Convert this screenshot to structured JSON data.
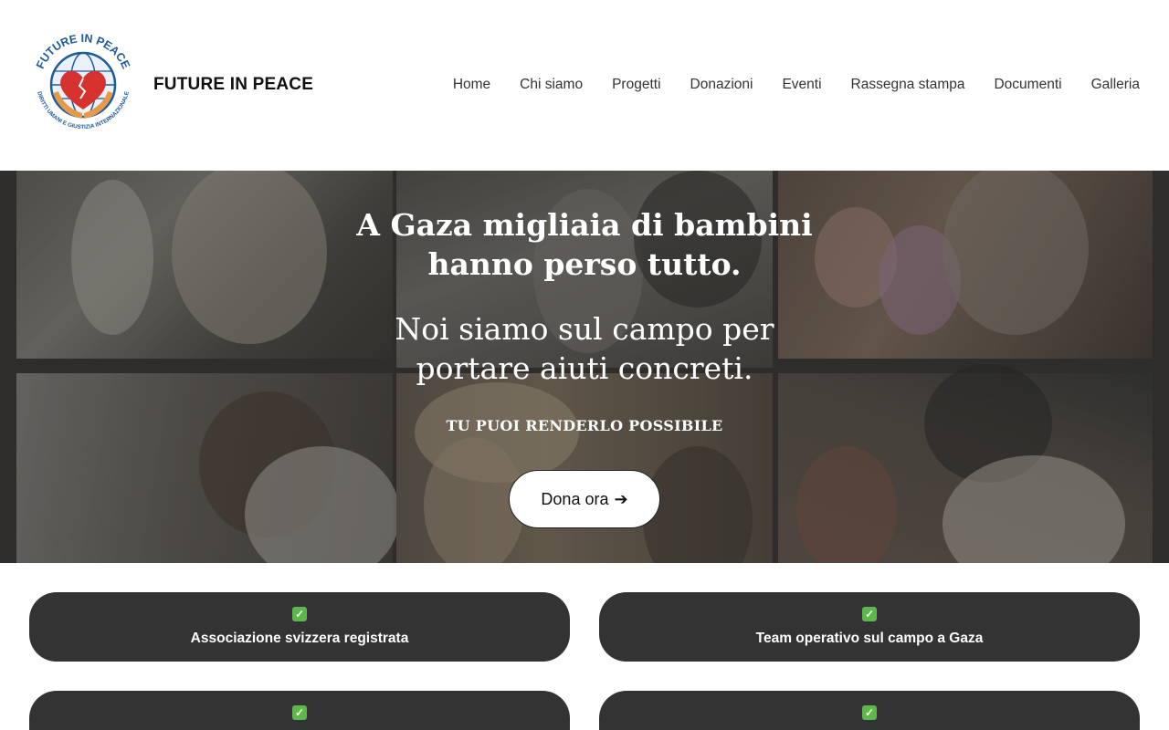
{
  "header": {
    "site_title": "FUTURE IN PEACE",
    "logo_text_top": "FUTURE IN PEACE",
    "logo_text_bottom": "DIRITTI UMANI E GIUSTIZIA INTERNAZIONALE",
    "nav": [
      "Home",
      "Chi siamo",
      "Progetti",
      "Donazioni",
      "Eventi",
      "Rassegna stampa",
      "Documenti",
      "Galleria"
    ]
  },
  "hero": {
    "headline_1": "A Gaza migliaia di bambini",
    "headline_2": "hanno perso tutto.",
    "subheadline_1": "Noi siamo sul campo per",
    "subheadline_2": "portare aiuti concreti.",
    "cta_text": "TU PUOI RENDERLO POSSIBILE",
    "donate_button": "Dona ora",
    "donate_arrow": "➔"
  },
  "features": {
    "check_icon": "✓",
    "items": [
      "Associazione svizzera registrata",
      "Team operativo sul campo a Gaza",
      "",
      ""
    ]
  },
  "colors": {
    "feature_bg": "#333333",
    "check_green": "#5cb84a",
    "logo_blue": "#1d5a9a",
    "logo_red": "#d6322e",
    "logo_orange": "#e59a4a"
  }
}
